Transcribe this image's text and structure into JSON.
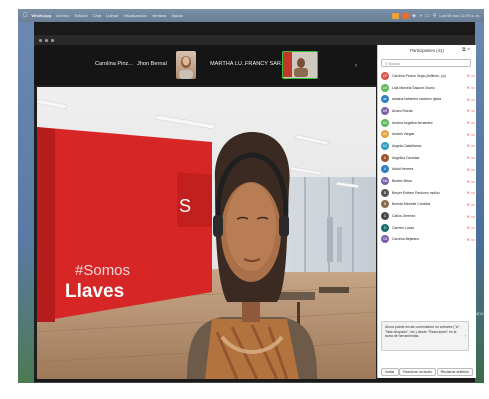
{
  "menubar": {
    "app": "WhatsApp",
    "items": [
      "Archivo",
      "Edición",
      "Chat",
      "Llamar",
      "Visualización",
      "Ventana",
      "Ayuda"
    ],
    "clock": "Lun 06 nov 11:09 a. m."
  },
  "desktop": {
    "right_label": "ADOS"
  },
  "strip": {
    "names": [
      "Carolina Pinz...",
      "Jhon Bernal",
      "MARTHA LU...",
      "FRANCY SAR..."
    ]
  },
  "video": {
    "wall_text_1": "#Somos",
    "wall_text_2": "Llaves",
    "wall_logo": "S"
  },
  "participants": {
    "title": "Participantes (41)",
    "search_placeholder": "Buscar",
    "list": [
      {
        "name": "Carolina Pinzón Vega (Anfitrión, yo)",
        "initials": "CP",
        "color": "#d9534f"
      },
      {
        "name": "Lida Marcela Salazar Osorio",
        "initials": "LM",
        "color": "#5cb85c"
      },
      {
        "name": "adriana katherine sanchez ojeda",
        "initials": "ak",
        "color": "#2d7fc1"
      },
      {
        "name": "Alvaro Rueda",
        "initials": "AR",
        "color": "#7b5ea7"
      },
      {
        "name": "Andrea Angelica fernandez",
        "initials": "AA",
        "color": "#5cb85c"
      },
      {
        "name": "Andres Vargas",
        "initials": "AV",
        "color": "#e0a23b"
      },
      {
        "name": "Angela Castellanos",
        "initials": "AC",
        "color": "#2d9ec1"
      },
      {
        "name": "Angelica Cavadas",
        "initials": "A",
        "color": "#a0522d"
      },
      {
        "name": "Astrid Herrera",
        "initials": "A",
        "color": "#2d7fc1"
      },
      {
        "name": "Beatriz Mesa",
        "initials": "BM",
        "color": "#7b5ea7"
      },
      {
        "name": "Breyer Estiven Pardomo muñoz",
        "initials": "B",
        "color": "#555555"
      },
      {
        "name": "Brenda Michelle Córdoba",
        "initials": "B",
        "color": "#8b6b4a"
      },
      {
        "name": "Carlos Jiménez",
        "initials": "C",
        "color": "#4a4a4a"
      },
      {
        "name": "Carmen Lucas",
        "initials": "C",
        "color": "#1e6e6e"
      },
      {
        "name": "Carolina Bejarano",
        "initials": "CB",
        "color": "#7b5ea7"
      }
    ],
    "tip": "Ahora puede enviar comentarios no verbales (\"sí\", \"Más despacio\", etc.) desde \"Reacciones\" en la barra de herramientas.",
    "buttons": [
      "Invitar",
      "Reactivar mi audio",
      "Reclamar anfitrión"
    ]
  }
}
